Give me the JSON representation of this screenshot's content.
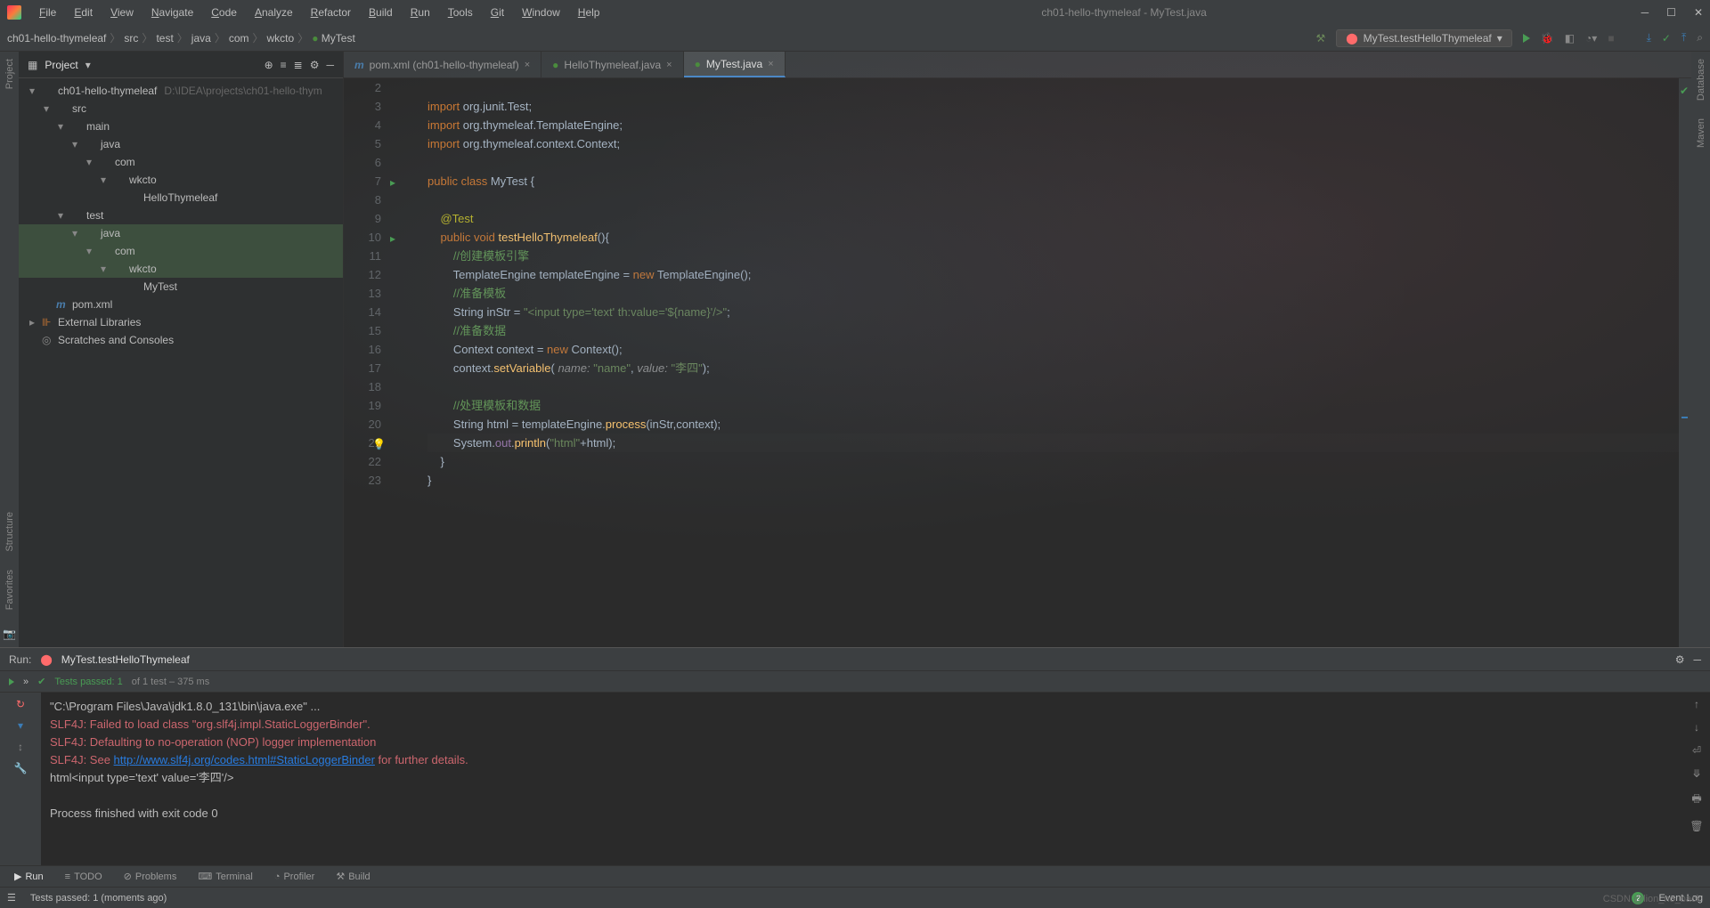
{
  "title": "ch01-hello-thymeleaf - MyTest.java",
  "menu": [
    "File",
    "Edit",
    "View",
    "Navigate",
    "Code",
    "Analyze",
    "Refactor",
    "Build",
    "Run",
    "Tools",
    "Git",
    "Window",
    "Help"
  ],
  "breadcrumb": [
    "ch01-hello-thymeleaf",
    "src",
    "test",
    "java",
    "com",
    "wkcto",
    "MyTest"
  ],
  "runConfig": "MyTest.testHelloThymeleaf",
  "projectPanel": {
    "title": "Project",
    "tree": [
      {
        "indent": 0,
        "arrow": "▾",
        "icon": "folder-proj",
        "label": "ch01-hello-thymeleaf",
        "dim": "D:\\IDEA\\projects\\ch01-hello-thym"
      },
      {
        "indent": 1,
        "arrow": "▾",
        "icon": "folder",
        "label": "src"
      },
      {
        "indent": 2,
        "arrow": "▾",
        "icon": "folder",
        "label": "main"
      },
      {
        "indent": 3,
        "arrow": "▾",
        "icon": "folder-src",
        "label": "java"
      },
      {
        "indent": 4,
        "arrow": "▾",
        "icon": "folder",
        "label": "com"
      },
      {
        "indent": 5,
        "arrow": "▾",
        "icon": "package",
        "label": "wkcto"
      },
      {
        "indent": 6,
        "arrow": "",
        "icon": "class",
        "label": "HelloThymeleaf"
      },
      {
        "indent": 2,
        "arrow": "▾",
        "icon": "folder",
        "label": "test"
      },
      {
        "indent": 3,
        "arrow": "▾",
        "icon": "folder-test",
        "label": "java",
        "selected": true
      },
      {
        "indent": 4,
        "arrow": "▾",
        "icon": "folder",
        "label": "com",
        "selected": true
      },
      {
        "indent": 5,
        "arrow": "▾",
        "icon": "package",
        "label": "wkcto",
        "selected": true
      },
      {
        "indent": 6,
        "arrow": "",
        "icon": "class",
        "label": "MyTest"
      },
      {
        "indent": 1,
        "arrow": "",
        "icon": "maven",
        "label": "pom.xml"
      },
      {
        "indent": 0,
        "arrow": "▸",
        "icon": "lib",
        "label": "External Libraries"
      },
      {
        "indent": 0,
        "arrow": "",
        "icon": "scratch",
        "label": "Scratches and Consoles"
      }
    ]
  },
  "editorTabs": [
    {
      "label": "pom.xml (ch01-hello-thymeleaf)",
      "icon": "maven",
      "active": false
    },
    {
      "label": "HelloThymeleaf.java",
      "icon": "class",
      "active": false
    },
    {
      "label": "MyTest.java",
      "icon": "class",
      "active": true
    }
  ],
  "code": {
    "startLine": 2,
    "lines": [
      {
        "n": 2,
        "html": ""
      },
      {
        "n": 3,
        "html": "<span class='kw'>import</span> org.junit.Test;"
      },
      {
        "n": 4,
        "html": "<span class='kw'>import</span> org.thymeleaf.TemplateEngine;"
      },
      {
        "n": 5,
        "html": "<span class='kw'>import</span> org.thymeleaf.context.Context;"
      },
      {
        "n": 6,
        "html": ""
      },
      {
        "n": 7,
        "html": "<span class='kw'>public class</span> MyTest {",
        "run": true
      },
      {
        "n": 8,
        "html": ""
      },
      {
        "n": 9,
        "html": "    <span class='ann'>@Test</span>"
      },
      {
        "n": 10,
        "html": "    <span class='kw'>public void</span> <span class='fn'>testHelloThymeleaf</span>(){",
        "run": true
      },
      {
        "n": 11,
        "html": "        <span class='comment'>//创建模板引擎</span>"
      },
      {
        "n": 12,
        "html": "        TemplateEngine templateEngine = <span class='kw'>new</span> TemplateEngine();"
      },
      {
        "n": 13,
        "html": "        <span class='comment'>//准备模板</span>"
      },
      {
        "n": 14,
        "html": "        String inStr = <span class='str'>\"&lt;input type='text' th:value='${name}'/&gt;\"</span>;"
      },
      {
        "n": 15,
        "html": "        <span class='comment'>//准备数据</span>"
      },
      {
        "n": 16,
        "html": "        Context context = <span class='kw'>new</span> Context();"
      },
      {
        "n": 17,
        "html": "        context.<span class='fn'>setVariable</span>( <span class='param'>name:</span> <span class='str'>\"name\"</span>, <span class='param'>value:</span> <span class='str'>\"李四\"</span>);"
      },
      {
        "n": 18,
        "html": ""
      },
      {
        "n": 19,
        "html": "        <span class='comment'>//处理模板和数据</span>"
      },
      {
        "n": 20,
        "html": "        String html = templateEngine.<span class='fn'>process</span>(inStr,context);"
      },
      {
        "n": 21,
        "html": "        System.<span style='color:#9876aa'>out</span>.<span class='fn'>println</span>(<span class='str'>\"html\"</span>+html);",
        "bulb": true
      },
      {
        "n": 22,
        "html": "    }"
      },
      {
        "n": 23,
        "html": "}"
      }
    ]
  },
  "runTab": {
    "label": "Run:",
    "config": "MyTest.testHelloThymeleaf",
    "testsPassed": "Tests passed: 1",
    "testsTotal": " of 1 test – 375 ms",
    "consoleLines": [
      {
        "cls": "",
        "text": "\"C:\\Program Files\\Java\\jdk1.8.0_131\\bin\\java.exe\" ..."
      },
      {
        "cls": "err",
        "text": "SLF4J: Failed to load class \"org.slf4j.impl.StaticLoggerBinder\"."
      },
      {
        "cls": "err",
        "text": "SLF4J: Defaulting to no-operation (NOP) logger implementation"
      },
      {
        "cls": "err",
        "html": "SLF4J: See <span class='link'>http://www.slf4j.org/codes.html#StaticLoggerBinder</span> for further details."
      },
      {
        "cls": "",
        "text": "html<input type='text' value='李四'/>"
      },
      {
        "cls": "",
        "text": ""
      },
      {
        "cls": "",
        "text": "Process finished with exit code 0"
      }
    ]
  },
  "toolTabs": [
    "Run",
    "TODO",
    "Problems",
    "Terminal",
    "Profiler",
    "Build"
  ],
  "status": {
    "left": "Tests passed: 1 (moments ago)",
    "eventLog": "Event Log",
    "eventCount": "2"
  },
  "rightGutter": [
    "Database",
    "Maven"
  ],
  "leftGutter": [
    "Project",
    "Structure",
    "Favorites"
  ],
  "watermark": "CSDN @lion_no_back"
}
